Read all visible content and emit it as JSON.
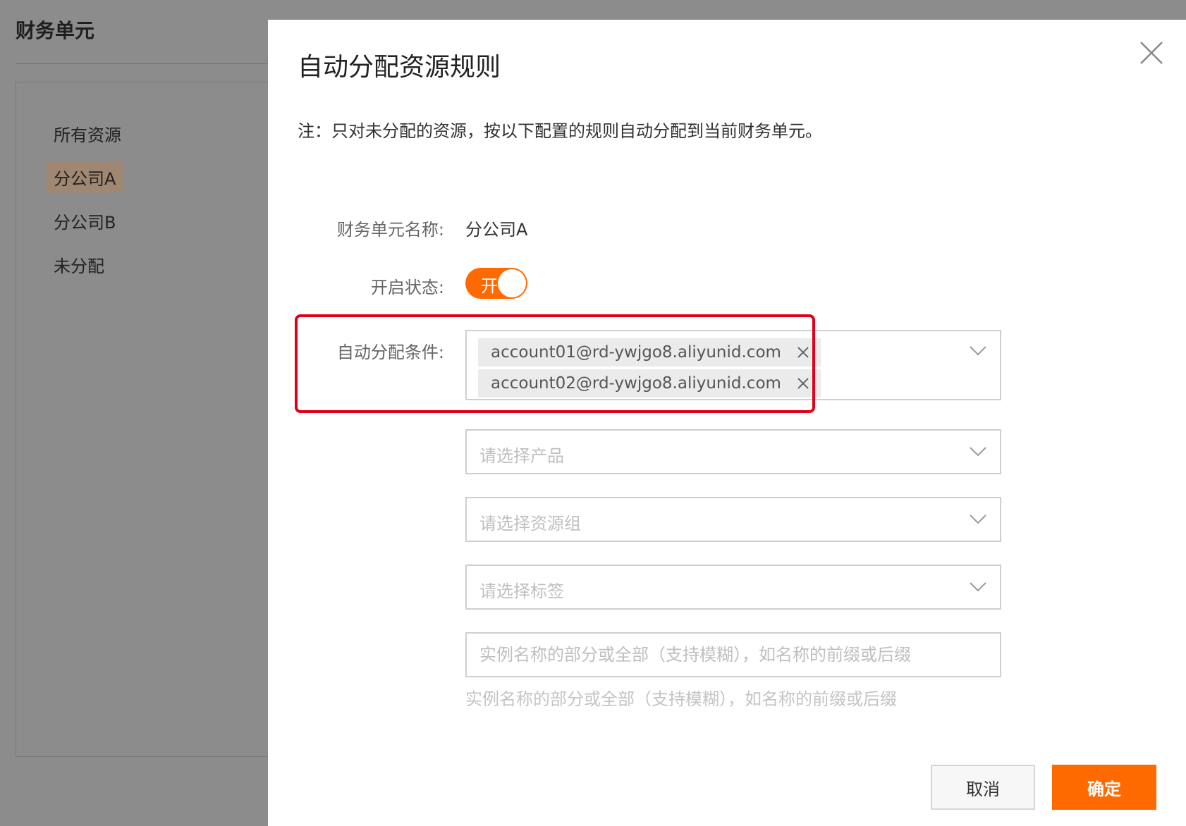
{
  "background": {
    "title": "财务单元",
    "items": [
      {
        "label": "所有资源",
        "active": false
      },
      {
        "label": "分公司A",
        "active": true
      },
      {
        "label": "分公司B",
        "active": false
      },
      {
        "label": "未分配",
        "active": false
      }
    ]
  },
  "modal": {
    "title": "自动分配资源规则",
    "note": "注：只对未分配的资源，按以下配置的规则自动分配到当前财务单元。",
    "unit_name_label": "财务单元名称:",
    "unit_name_value": "分公司A",
    "status_label": "开启状态:",
    "status_toggle_text": "开",
    "status_on": true,
    "condition_label": "自动分配条件:",
    "accounts": [
      "account01@rd-ywjgo8.aliyunid.com",
      "account02@rd-ywjgo8.aliyunid.com"
    ],
    "product_placeholder": "请选择产品",
    "resource_group_placeholder": "请选择资源组",
    "tag_placeholder": "请选择标签",
    "instance_name_placeholder": "实例名称的部分或全部（支持模糊），如名称的前缀或后缀",
    "instance_name_hint": "实例名称的部分或全部（支持模糊），如名称的前缀或后缀",
    "cancel_label": "取消",
    "ok_label": "确定"
  },
  "colors": {
    "accent": "#ff6a00",
    "highlight": "#e0001a"
  }
}
